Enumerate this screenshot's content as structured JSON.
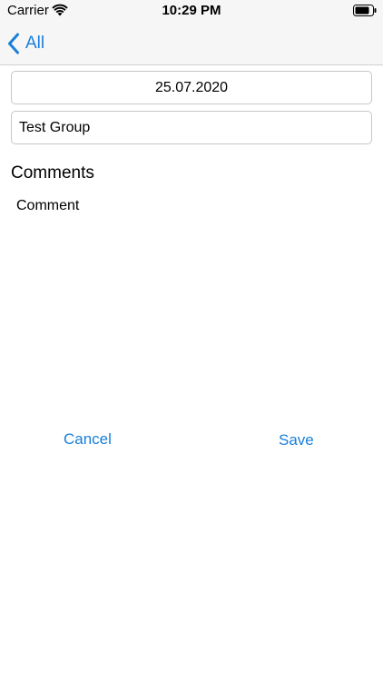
{
  "status_bar": {
    "carrier": "Carrier",
    "time": "10:29 PM",
    "wifi_icon": "wifi-icon",
    "battery_icon": "battery-icon"
  },
  "nav": {
    "back_label": "All",
    "back_icon": "chevron-left-icon",
    "accent_color": "#1a7fd8"
  },
  "form": {
    "date_value": "25.07.2020",
    "group_value": "Test Group",
    "comments_heading": "Comments",
    "comment_text": "Comment"
  },
  "actions": {
    "cancel_label": "Cancel",
    "save_label": "Save"
  }
}
